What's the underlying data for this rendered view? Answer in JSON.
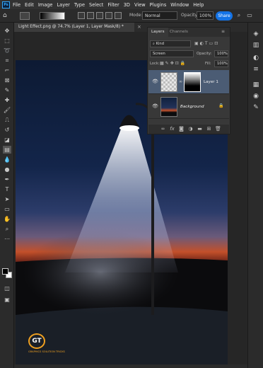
{
  "menubar": {
    "app_icon": "Ps",
    "items": [
      "File",
      "Edit",
      "Image",
      "Layer",
      "Type",
      "Select",
      "Filter",
      "3D",
      "View",
      "Plugins",
      "Window",
      "Help"
    ]
  },
  "options": {
    "mode_label": "Mode:",
    "mode_value": "Normal",
    "opacity_label": "Opacity:",
    "opacity_value": "100%",
    "share_label": "Share"
  },
  "document": {
    "tab_title": "Light Effect.png @ 74.7% (Layer 1, Layer Mask/8) *"
  },
  "layers_panel": {
    "tabs": [
      "Layers",
      "Channels"
    ],
    "filter_kind": "Kind",
    "blend_mode": "Screen",
    "opacity_label": "Opacity:",
    "opacity_value": "100%",
    "lock_label": "Lock:",
    "fill_label": "Fill:",
    "fill_value": "100%",
    "layers": [
      {
        "name": "Layer 1",
        "selected": true
      },
      {
        "name": "Background",
        "selected": false
      }
    ]
  },
  "watermark": {
    "logo_letters": "GT",
    "caption": "GRAPHICS SOLUTION TRICKS"
  },
  "colors": {
    "accent": "#1473e6",
    "panel_bg": "#383838",
    "layer_selected": "#4b5c74"
  }
}
